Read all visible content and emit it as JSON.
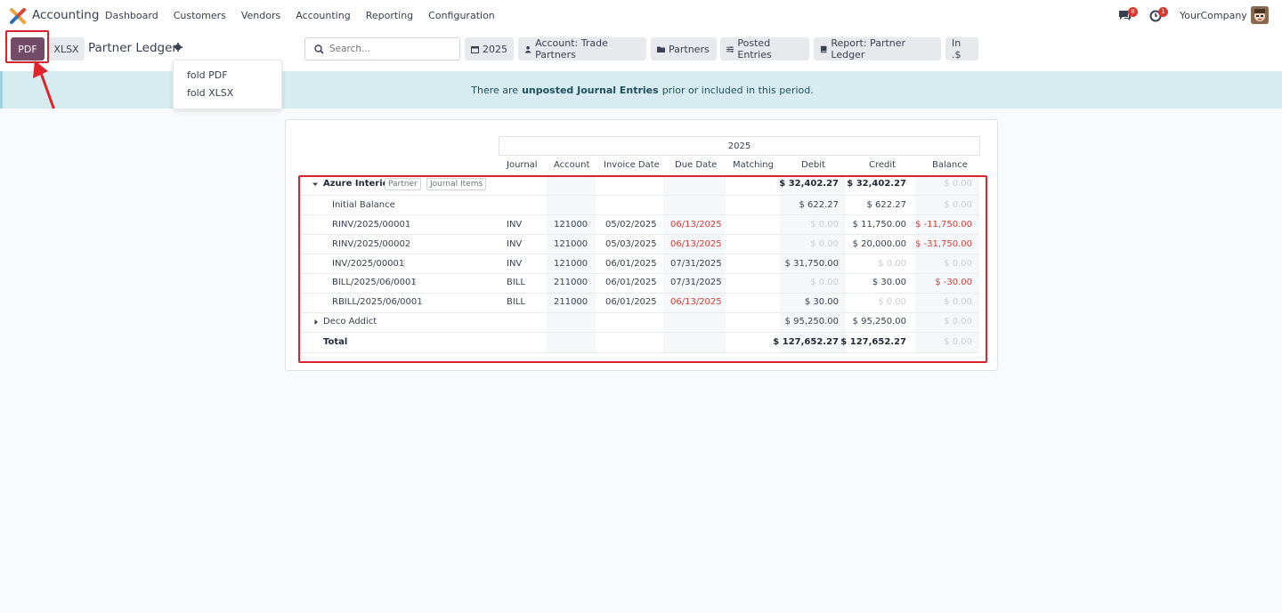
{
  "navbar": {
    "app_name": "Accounting",
    "menu": [
      "Dashboard",
      "Customers",
      "Vendors",
      "Accounting",
      "Reporting",
      "Configuration"
    ],
    "chat_count": "8",
    "activity_count": "1",
    "company": "YourCompany"
  },
  "control_panel": {
    "pdf_label": "PDF",
    "xlsx_label": "XLSX",
    "report_title": "Partner Ledger",
    "search_placeholder": "Search...",
    "filters": [
      "2025",
      "Account: Trade Partners",
      "Partners",
      "Posted Entries",
      "Report: Partner Ledger",
      "In .$"
    ]
  },
  "dropdown": {
    "items": [
      "fold PDF",
      "fold XLSX"
    ]
  },
  "alert": {
    "prefix": "There are",
    "bold": "unposted Journal Entries",
    "suffix": "prior or included in this period."
  },
  "report": {
    "period": "2025",
    "columns": [
      "Journal",
      "Account",
      "Invoice Date",
      "Due Date",
      "Matching",
      "Debit",
      "Credit",
      "Balance"
    ],
    "partner_group": {
      "name": "Azure Interior",
      "tag_partner": "Partner",
      "tag_items": "Journal Items",
      "debit": "$ 32,402.27",
      "credit": "$ 32,402.27",
      "balance": "$ 0.00"
    },
    "initial_balance": {
      "label": "Initial Balance",
      "debit": "$ 622.27",
      "credit": "$ 622.27",
      "balance": "$ 0.00"
    },
    "lines": [
      {
        "name": "RINV/2025/00001",
        "journal": "INV",
        "account": "121000",
        "invoice_date": "05/02/2025",
        "due_date": "06/13/2025",
        "debit": "$ 0.00",
        "credit": "$ 11,750.00",
        "balance": "$ -11,750.00"
      },
      {
        "name": "RINV/2025/00002",
        "journal": "INV",
        "account": "121000",
        "invoice_date": "05/03/2025",
        "due_date": "06/13/2025",
        "debit": "$ 0.00",
        "credit": "$ 20,000.00",
        "balance": "$ -31,750.00"
      },
      {
        "name": "INV/2025/00001",
        "journal": "INV",
        "account": "121000",
        "invoice_date": "06/01/2025",
        "due_date": "07/31/2025",
        "debit": "$ 31,750.00",
        "credit": "$ 0.00",
        "balance": "$ 0.00"
      },
      {
        "name": "BILL/2025/06/0001",
        "journal": "BILL",
        "account": "211000",
        "invoice_date": "06/01/2025",
        "due_date": "07/31/2025",
        "debit": "$ 0.00",
        "credit": "$ 30.00",
        "balance": "$ -30.00"
      },
      {
        "name": "RBILL/2025/06/0001",
        "journal": "BILL",
        "account": "211000",
        "invoice_date": "06/01/2025",
        "due_date": "06/13/2025",
        "debit": "$ 30.00",
        "credit": "$ 0.00",
        "balance": "$ 0.00"
      }
    ],
    "second_partner": {
      "name": "Deco Addict",
      "debit": "$ 95,250.00",
      "credit": "$ 95,250.00",
      "balance": "$ 0.00"
    },
    "total": {
      "label": "Total",
      "debit": "$ 127,652.27",
      "credit": "$ 127,652.27",
      "balance": "$ 0.00"
    }
  },
  "colors": {
    "brand": "#714b67",
    "negative": "#d23f3a",
    "highlight": "#d9232d",
    "alert_bg": "#d7ecf0"
  }
}
